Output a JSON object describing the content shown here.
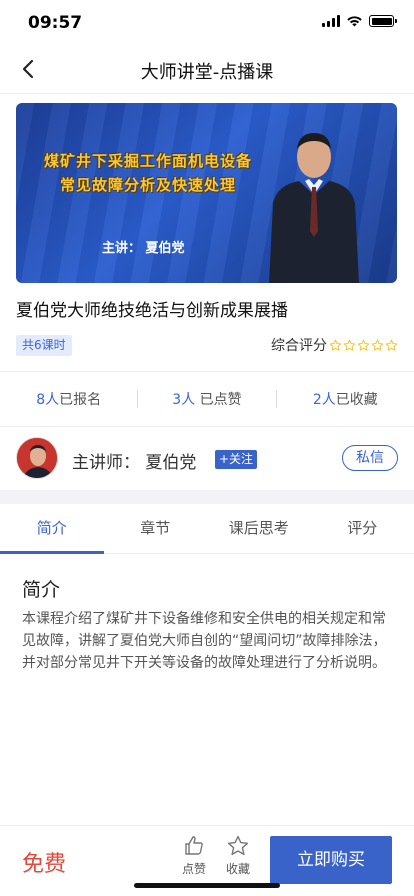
{
  "status_bar": {
    "time": "09:57"
  },
  "nav": {
    "title": "大师讲堂-点播课"
  },
  "banner": {
    "title_line1": "煤矿井下采掘工作面机电设备",
    "title_line2": "常见故障分析及快速处理",
    "speaker": "主讲：   夏伯党"
  },
  "course": {
    "title": "夏伯党大师绝技绝活与创新成果展播",
    "lessons": "共6课时",
    "rating_label": "综合评分",
    "rating_stars": 0,
    "rating_max": 5
  },
  "stats": [
    {
      "num": "8人",
      "label": "已报名"
    },
    {
      "num": "3人",
      "label": " 已点赞"
    },
    {
      "num": "2人",
      "label": "已收藏"
    }
  ],
  "teacher": {
    "name": "主讲师：  夏伯党",
    "follow": "+关注",
    "message": "私信"
  },
  "tabs": [
    {
      "label": "简介",
      "active": true
    },
    {
      "label": "章节",
      "active": false
    },
    {
      "label": "课后思考",
      "active": false
    },
    {
      "label": "评分",
      "active": false
    }
  ],
  "intro": {
    "heading": "简介",
    "body": "本课程介绍了煤矿井下设备维修和安全供电的相关规定和常见故障，讲解了夏伯党大师自创的“望闻问切”故障排除法，并对部分常见井下开关等设备的故障处理进行了分析说明。"
  },
  "bottom_bar": {
    "price": "免费",
    "like_label": "点赞",
    "favorite_label": "收藏",
    "buy_label": "立即购买"
  },
  "colors": {
    "accent": "#3a63c9",
    "price": "#e24a3b",
    "star": "#f2c230"
  }
}
